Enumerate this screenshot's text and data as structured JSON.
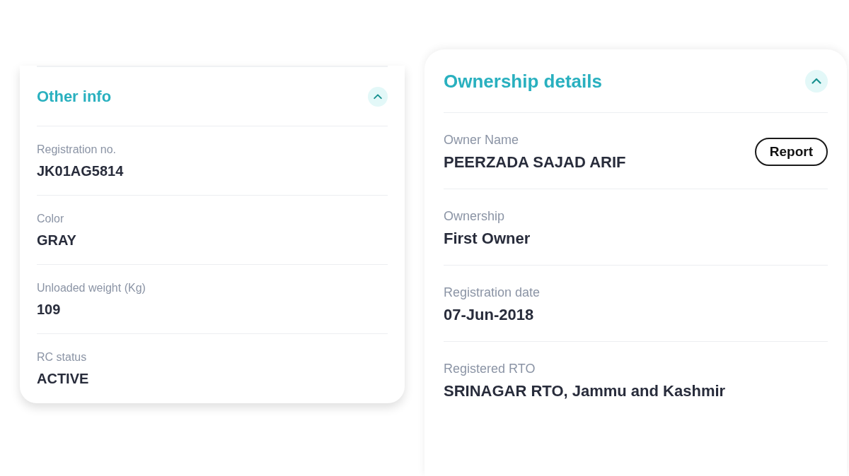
{
  "panels": [
    {
      "title": "Other info",
      "expanded": true,
      "fields": [
        {
          "label": "Registration no.",
          "value": "JK01AG5814"
        },
        {
          "label": "Color",
          "value": "GRAY"
        },
        {
          "label": "Unloaded weight (Kg)",
          "value": "109"
        },
        {
          "label": "RC status",
          "value": "ACTIVE"
        }
      ]
    },
    {
      "title": "Ownership details",
      "expanded": true,
      "fields": [
        {
          "label": "Owner Name",
          "value": "PEERZADA SAJAD ARIF",
          "action": "Report"
        },
        {
          "label": "Ownership",
          "value": "First Owner"
        },
        {
          "label": "Registration date",
          "value": "07-Jun-2018"
        },
        {
          "label": "Registered RTO",
          "value": "SRINAGAR RTO, Jammu and Kashmir"
        }
      ]
    }
  ]
}
